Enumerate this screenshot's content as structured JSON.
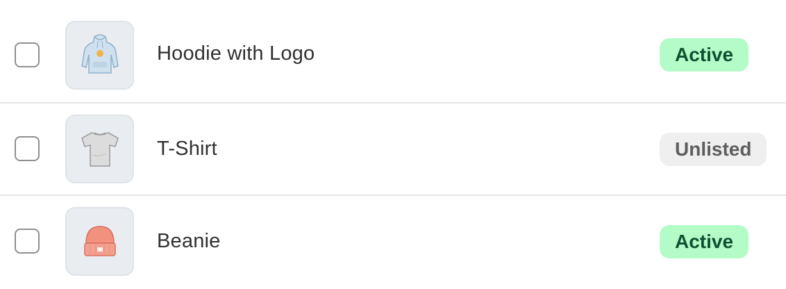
{
  "products": [
    {
      "name": "Hoodie with Logo",
      "status": "Active",
      "status_kind": "active",
      "image_icon": "hoodie-icon"
    },
    {
      "name": "T-Shirt",
      "status": "Unlisted",
      "status_kind": "unlisted",
      "image_icon": "tshirt-icon"
    },
    {
      "name": "Beanie",
      "status": "Active",
      "status_kind": "active",
      "image_icon": "beanie-icon"
    }
  ],
  "colors": {
    "active_bg": "#b4fcc7",
    "active_text": "#0c5132",
    "unlisted_bg": "#efefef",
    "unlisted_text": "#5e5e5e",
    "divider": "#e3e3e3"
  }
}
